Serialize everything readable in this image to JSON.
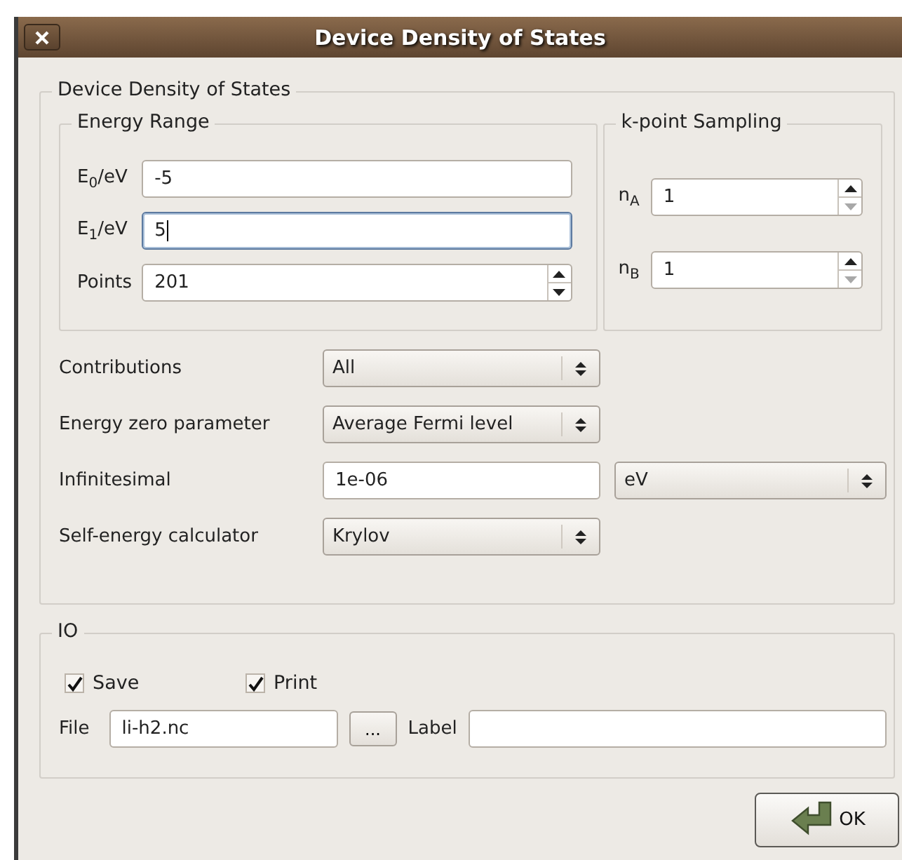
{
  "window": {
    "title": "Device Density of States"
  },
  "main_group": {
    "title": "Device Density of States",
    "energy_range": {
      "title": "Energy Range",
      "fields": [
        {
          "label": "E$_{0}$/eV",
          "value": "-5",
          "kind": "text",
          "focused": false
        },
        {
          "label": "E$_{1}$/eV",
          "value": "5",
          "kind": "text",
          "focused": true
        },
        {
          "label": "Points",
          "value": "201",
          "kind": "spin",
          "focused": false,
          "at_minimum": false
        }
      ]
    },
    "kpoint_sampling": {
      "title": "k-point Sampling",
      "fields": [
        {
          "label": "n$_{A}$",
          "value": "1",
          "kind": "spin",
          "focused": false,
          "at_minimum": true
        },
        {
          "label": "n$_{B}$",
          "value": "1",
          "kind": "spin",
          "focused": false,
          "at_minimum": true
        }
      ]
    },
    "settings": [
      {
        "label": "Contributions",
        "kind": "combo",
        "value": "All"
      },
      {
        "label": "Energy zero parameter",
        "kind": "combo",
        "value": "Average Fermi level"
      },
      {
        "label": "Infinitesimal",
        "kind": "field_unit",
        "value": "1e-06",
        "unit": "eV"
      },
      {
        "label": "Self-energy calculator",
        "kind": "combo",
        "value": "Krylov"
      }
    ]
  },
  "io": {
    "title": "IO",
    "checkboxes": [
      {
        "label": "Save",
        "checked": true
      },
      {
        "label": "Print",
        "checked": true
      }
    ],
    "file": {
      "label": "File",
      "value": "li-h2.nc",
      "browse": "..."
    },
    "label_field": {
      "label": "Label"
    }
  },
  "buttons": [
    {
      "label": "OK"
    }
  ]
}
